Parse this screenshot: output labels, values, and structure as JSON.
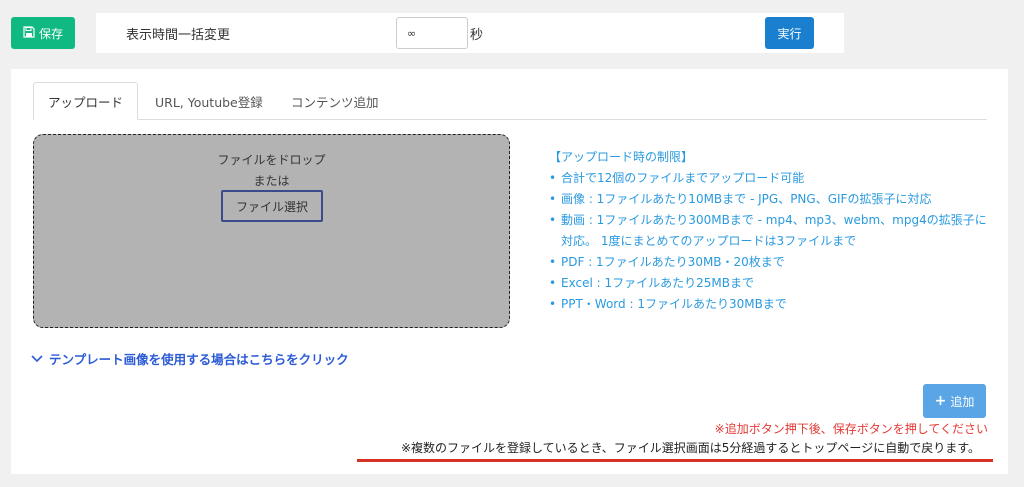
{
  "toolbar": {
    "save_label": "保存",
    "bulk_label": "表示時間一括変更",
    "duration_value": "∞",
    "unit": "秒",
    "run_label": "実行"
  },
  "tabs": [
    {
      "label": "アップロード",
      "active": true
    },
    {
      "label": "URL, Youtube登録",
      "active": false
    },
    {
      "label": "コンテンツ追加",
      "active": false
    }
  ],
  "dropzone": {
    "line1": "ファイルをドロップ",
    "line2": "または",
    "select_label": "ファイル選択"
  },
  "limits": {
    "title": "【アップロード時の制限】",
    "items": [
      "合計で12個のファイルまでアップロード可能",
      "画像 : 1ファイルあたり10MBまで - JPG、PNG、GIFの拡張子に対応",
      "動画 : 1ファイルあたり300MBまで - mp4、mp3、webm、mpg4の拡張子に対応。 1度にまとめてのアップロードは3ファイルまで",
      "PDF : 1ファイルあたり30MB・20枚まで",
      "Excel : 1ファイルあたり25MBまで",
      "PPT・Word : 1ファイルあたり30MBまで"
    ]
  },
  "template_link": "テンプレート画像を使用する場合はこちらをクリック",
  "add_label": "追加",
  "notes": {
    "red": "※追加ボタン押下後、保存ボタンを押してください",
    "black": "※複数のファイルを登録しているとき、ファイル選択画面は5分経過するとトップページに自動で戻ります。"
  },
  "colors": {
    "save": "#10b981",
    "run": "#1a7fcf",
    "add": "#5aa5e6",
    "limits_text": "#2a9ae0",
    "link": "#2c5bd6",
    "warning": "#e53935",
    "underline": "#d93025"
  }
}
